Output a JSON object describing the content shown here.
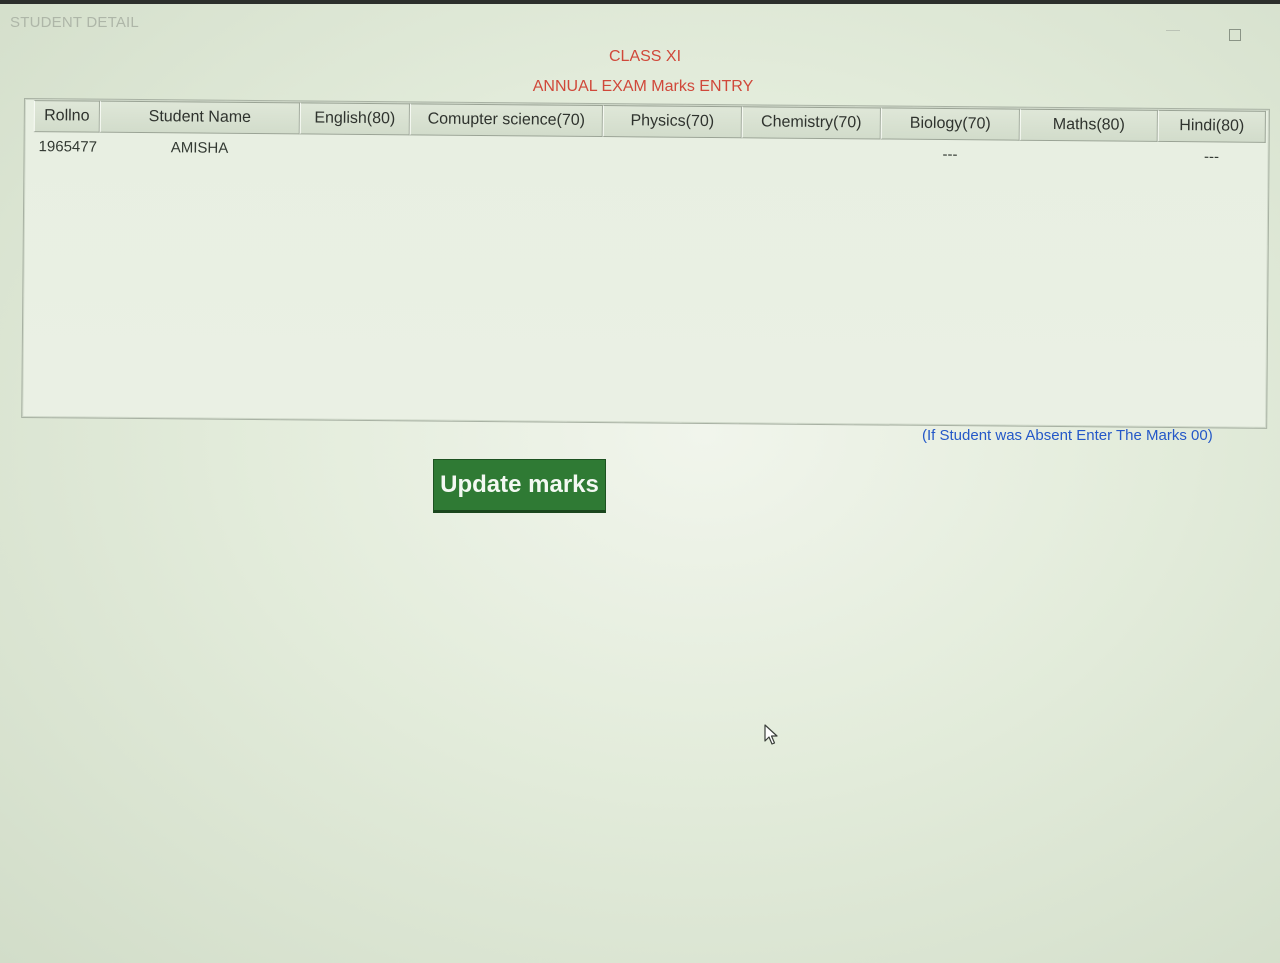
{
  "window": {
    "title": "STUDENT DETAIL",
    "minimize_glyph": "—",
    "maximize_icon": "maximize-icon"
  },
  "header": {
    "class_label": "CLASS XI",
    "entry_label": "ANNUAL EXAM Marks ENTRY"
  },
  "grid": {
    "columns": [
      "Rollno",
      "Student Name",
      "English(80)",
      "Comupter science(70)",
      "Physics(70)",
      "Chemistry(70)",
      "Biology(70)",
      "Maths(80)",
      "Hindi(80)"
    ],
    "rows": [
      [
        "1965477",
        "AMISHA",
        "",
        "",
        "",
        "",
        "---",
        "",
        "---"
      ]
    ]
  },
  "note": "(If Student was Absent Enter The Marks 00)",
  "actions": {
    "update_label": "Update marks"
  },
  "colors": {
    "heading": "#d0483a",
    "note": "#2458c8",
    "button": "#2f7a34"
  },
  "icons": {
    "cursor": "mouse-pointer-icon"
  }
}
